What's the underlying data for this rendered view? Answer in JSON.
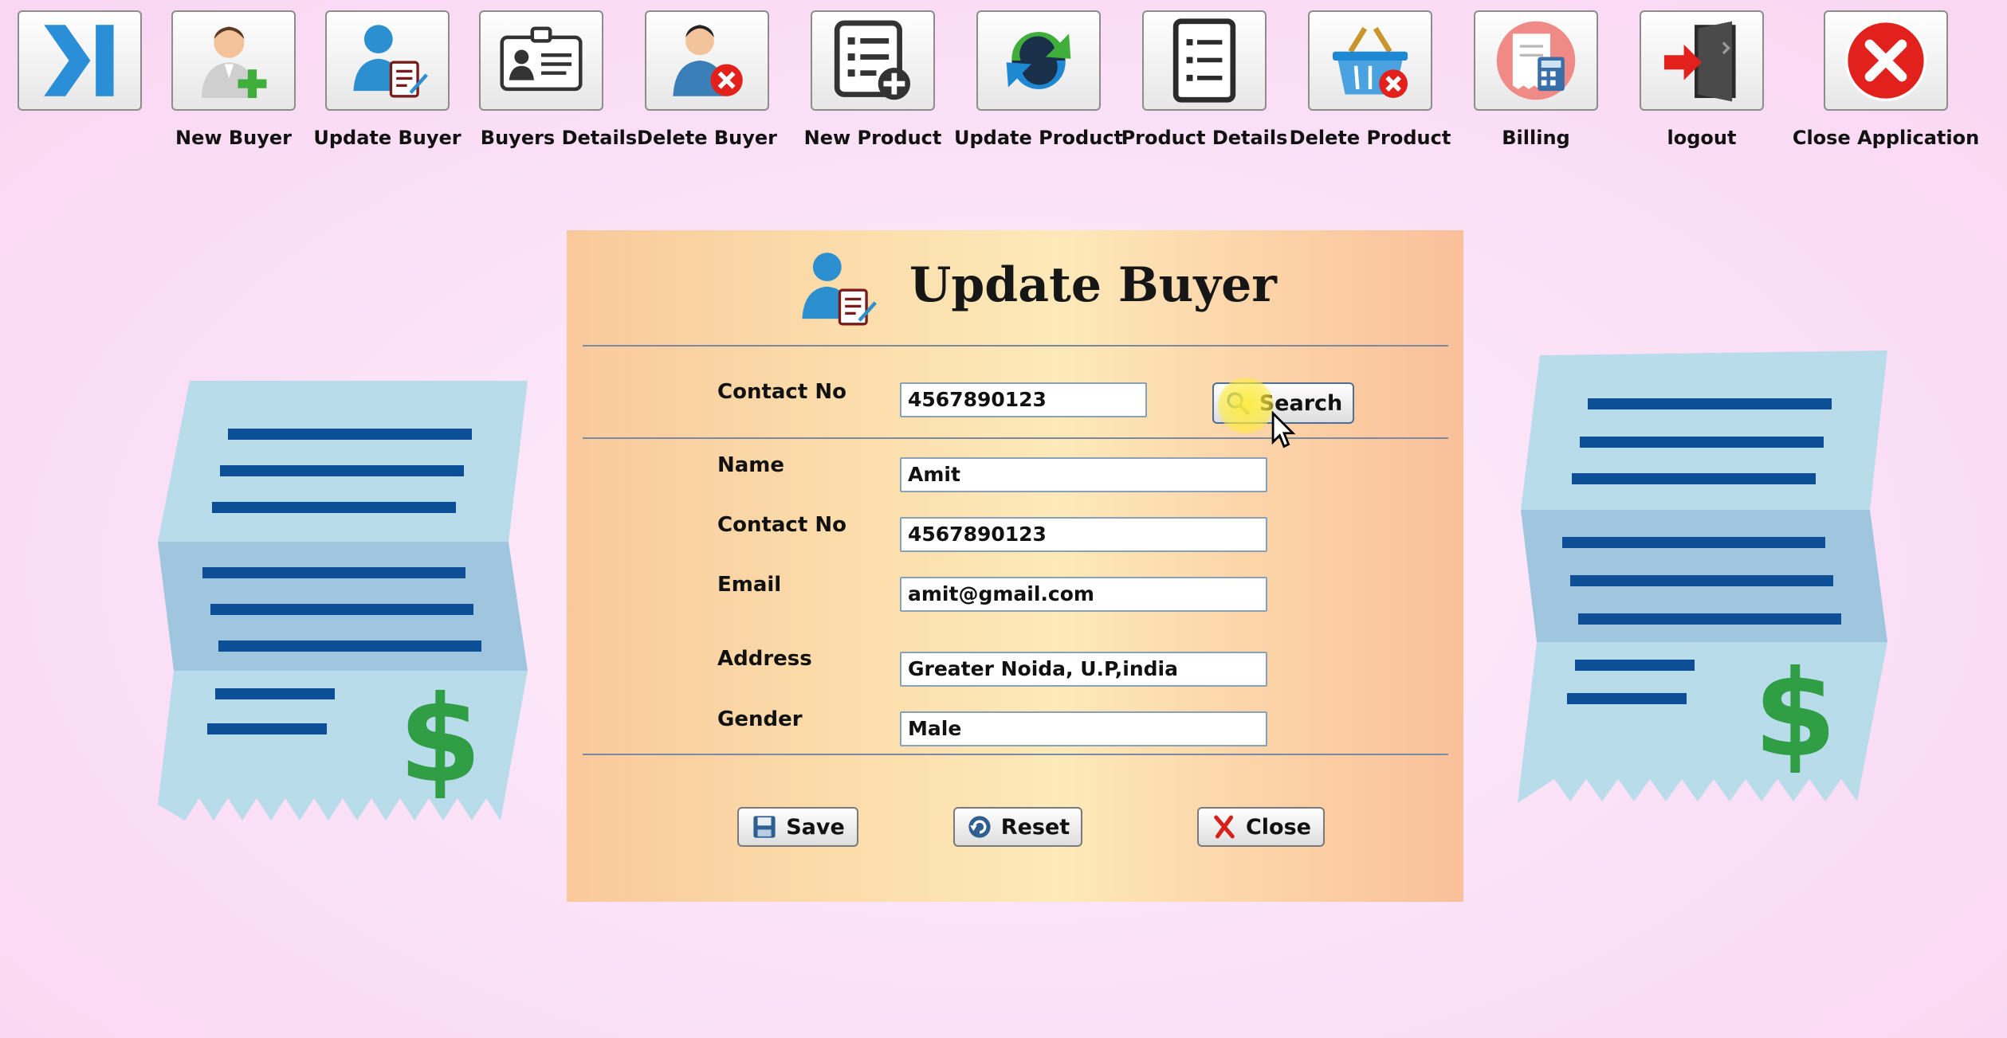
{
  "toolbar": {
    "items": [
      {
        "label": "",
        "icon": "expand-icon"
      },
      {
        "label": "New Buyer",
        "icon": "add-user-icon"
      },
      {
        "label": "Update Buyer",
        "icon": "update-user-icon"
      },
      {
        "label": "Buyers Details",
        "icon": "id-card-icon"
      },
      {
        "label": "Delete Buyer",
        "icon": "delete-user-icon"
      },
      {
        "label": "New Product",
        "icon": "add-list-icon"
      },
      {
        "label": "Update Product",
        "icon": "refresh-icon"
      },
      {
        "label": "Product Details",
        "icon": "list-icon"
      },
      {
        "label": "Delete Product",
        "icon": "basket-delete-icon"
      },
      {
        "label": "Billing",
        "icon": "calculator-receipt-icon"
      },
      {
        "label": "logout",
        "icon": "logout-door-icon"
      },
      {
        "label": "Close Application",
        "icon": "close-circle-icon"
      }
    ]
  },
  "form": {
    "title": "Update Buyer",
    "search": {
      "label": "Contact No",
      "value": "4567890123",
      "button": "Search"
    },
    "fields": [
      {
        "label": "Name",
        "value": "Amit"
      },
      {
        "label": "Contact No",
        "value": "4567890123"
      },
      {
        "label": "Email",
        "value": "amit@gmail.com"
      },
      {
        "label": "Address",
        "value": "Greater Noida, U.P,india"
      },
      {
        "label": "Gender",
        "value": "Male"
      }
    ],
    "buttons": {
      "save": "Save",
      "reset": "Reset",
      "close": "Close"
    }
  },
  "colors": {
    "receipt": "#b9dceb",
    "receipt_lines": "#0d4f96",
    "dollar": "#2f9e44",
    "close_red": "#e2211c"
  }
}
